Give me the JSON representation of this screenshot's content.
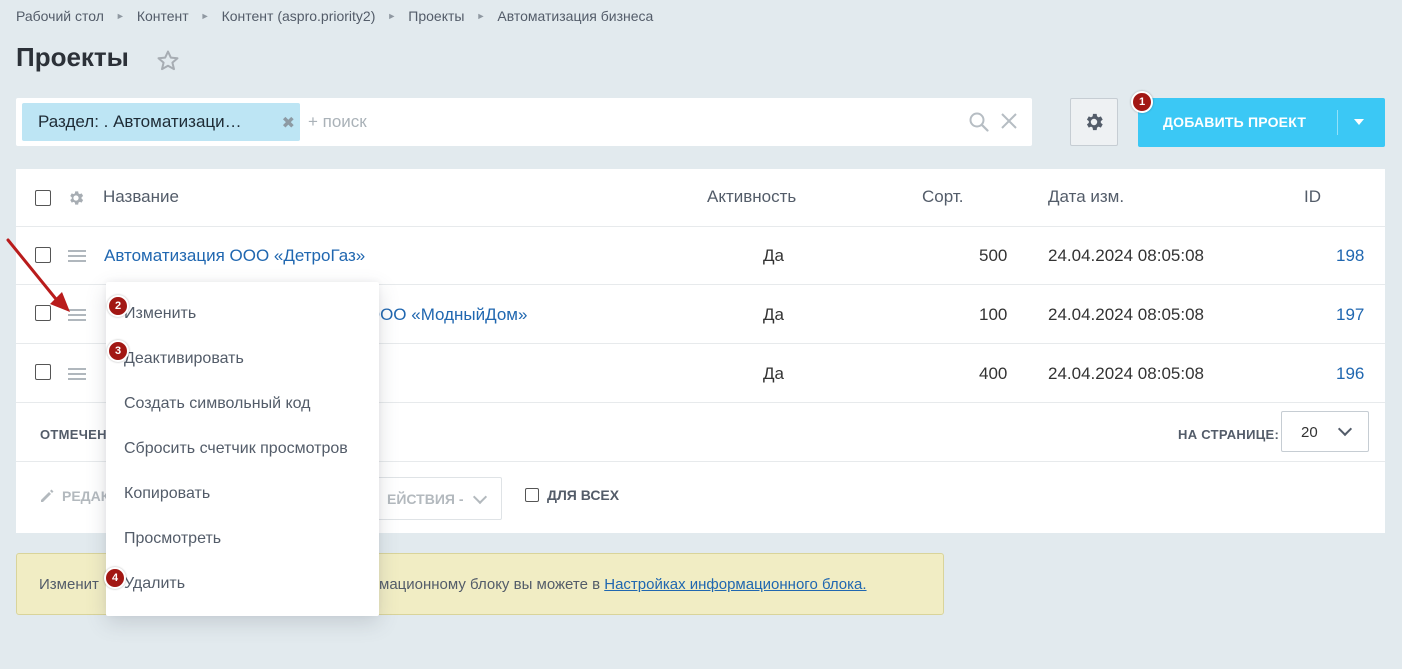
{
  "breadcrumb": [
    "Рабочий стол",
    "Контент",
    "Контент (aspro.priority2)",
    "Проекты",
    "Автоматизация бизнеса"
  ],
  "page_title": "Проекты",
  "filter": {
    "tag_label": "Раздел: . Автоматизаци…",
    "search_placeholder": "+ поиск"
  },
  "toolbar": {
    "add_button_label": "ДОБАВИТЬ ПРОЕКТ"
  },
  "badges": {
    "b1": "1",
    "b2": "2",
    "b3": "3",
    "b4": "4"
  },
  "table": {
    "columns": {
      "name": "Название",
      "active": "Активность",
      "sort": "Сорт.",
      "date": "Дата изм.",
      "id": "ID"
    },
    "rows": [
      {
        "name": "Автоматизация ООО «ДетроГаз»",
        "active": "Да",
        "sort": "500",
        "date": "24.04.2024 08:05:08",
        "id": "198"
      },
      {
        "name": "ля ООО «МодныйДом»",
        "active": "Да",
        "sort": "100",
        "date": "24.04.2024 08:05:08",
        "id": "197"
      },
      {
        "name": "",
        "active": "Да",
        "sort": "400",
        "date": "24.04.2024 08:05:08",
        "id": "196"
      }
    ]
  },
  "footer": {
    "marked_label": "ОТМЕЧЕН",
    "per_page_label": "НА СТРАНИЦЕ:",
    "per_page_value": "20",
    "edit_label": "РЕДАК",
    "actions_label": "ЕЙСТВИЯ -",
    "for_all_label": "ДЛЯ ВСЕХ"
  },
  "notice": {
    "text_start": "Изменит",
    "text_mid": "мационному блоку вы можете в ",
    "link": "Настройках информационного блока."
  },
  "context_menu": [
    "Изменить",
    "Деактивировать",
    "Создать символьный код",
    "Сбросить счетчик просмотров",
    "Копировать",
    "Просмотреть",
    "Удалить"
  ],
  "colors": {
    "accent": "#3bc8f5",
    "link": "#2067b0",
    "badge": "#a21713",
    "background": "#e2eaee"
  }
}
